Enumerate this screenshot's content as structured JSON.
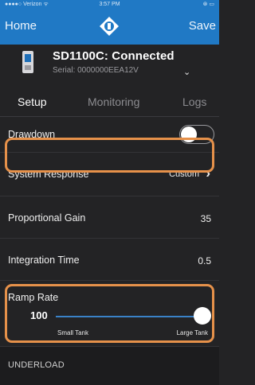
{
  "status_bar": {
    "carrier": "●●●●○ Verizon ᯤ",
    "time": "3:57 PM",
    "right": "⊛ ▭"
  },
  "nav": {
    "home_label": "Home",
    "save_label": "Save",
    "logo_icon": "brand-logo-icon"
  },
  "device": {
    "title": "SD1100C: Connected",
    "serial": "Serial: 0000000EEA12V",
    "chevron": "⌄"
  },
  "tabs": [
    {
      "label": "Setup",
      "active": true
    },
    {
      "label": "Monitoring",
      "active": false
    },
    {
      "label": "Logs",
      "active": false
    }
  ],
  "settings": {
    "drawdown": {
      "label": "Drawdown",
      "enabled": false
    },
    "system_response": {
      "label": "System Response",
      "value": "Custom",
      "chevron": "›"
    },
    "proportional_gain": {
      "label": "Proportional Gain",
      "value": "35"
    },
    "integration_time": {
      "label": "Integration Time",
      "value": "0.5"
    },
    "ramp_rate": {
      "label": "Ramp Rate",
      "value": "100",
      "min_label": "Small Tank",
      "max_label": "Large Tank",
      "level_fraction": 1.0
    }
  },
  "section": {
    "label": "UNDERLOAD"
  },
  "colors": {
    "nav_blue": "#2079c5",
    "highlight_orange": "#e6914a",
    "background": "#232325"
  }
}
